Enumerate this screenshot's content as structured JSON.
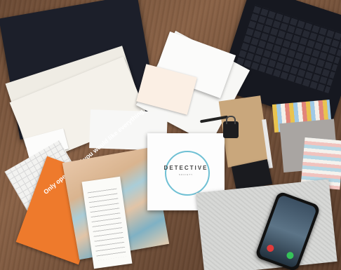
{
  "photo": {
    "orange_flyer_text": "Only open this if you would like everything",
    "detective_card": {
      "title": "DETECTIVE",
      "subtitle": "SOCIETY"
    }
  },
  "colors": {
    "table": "#7a563d",
    "orange": "#ee7a2c",
    "card_circle": "#6fc0d4",
    "phone_decline": "#e23b3b",
    "phone_accept": "#35c259"
  }
}
